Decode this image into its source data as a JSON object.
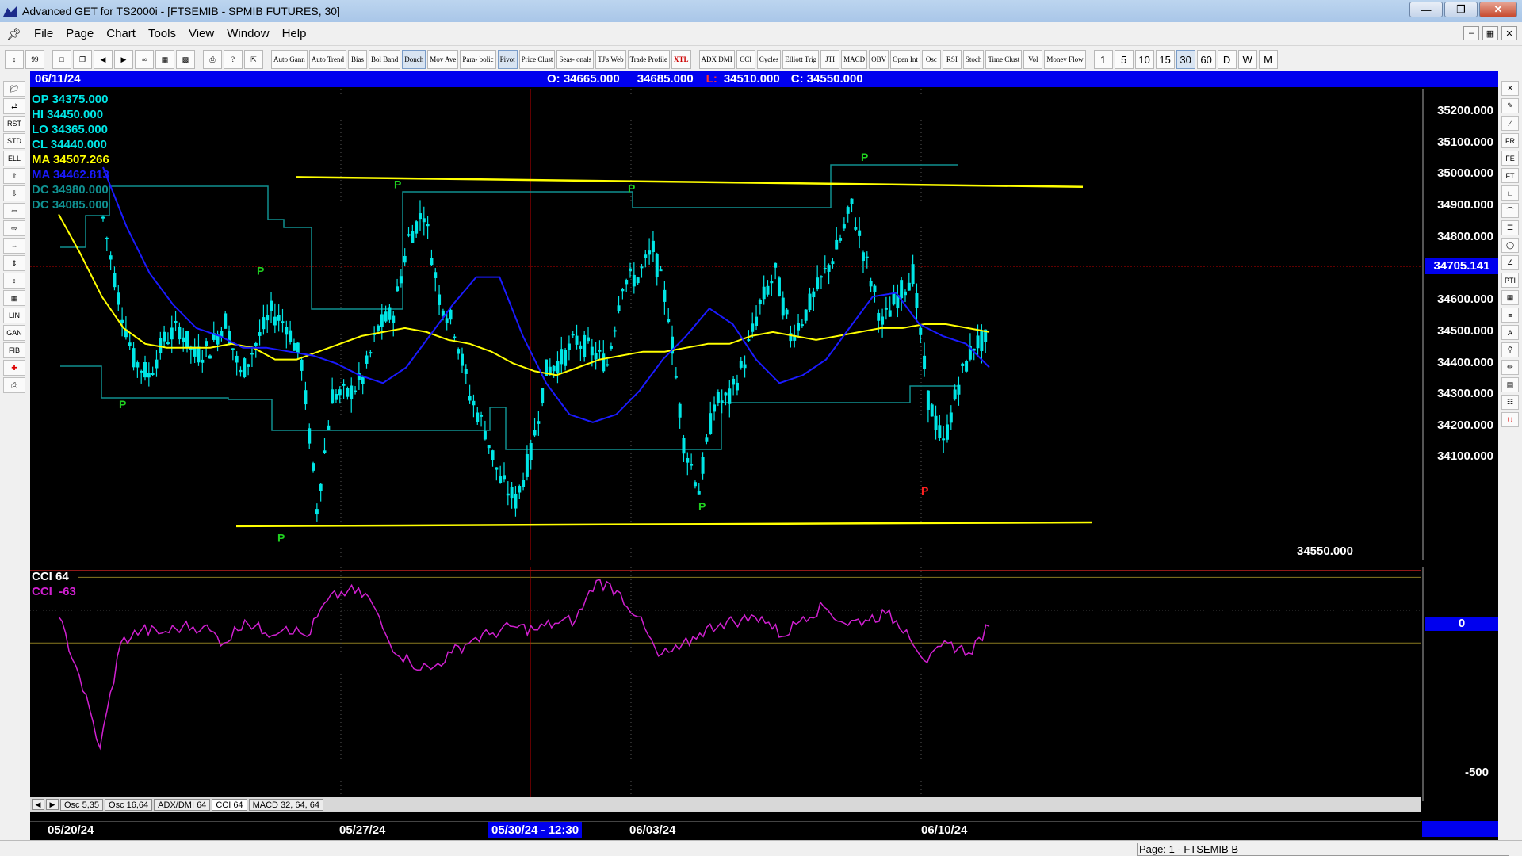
{
  "window": {
    "title": "Advanced GET for TS2000i - [FTSEMIB - SPMIB FUTURES, 30]",
    "minimize": "—",
    "maximize": "❒",
    "close": "✕"
  },
  "menu": [
    "File",
    "Page",
    "Chart",
    "Tools",
    "View",
    "Window",
    "Help"
  ],
  "toolbar": {
    "studies": [
      "Auto Gann",
      "Auto Trend",
      "Bias",
      "Bol Band",
      "Donch",
      "Mov Ave",
      "Para- bolic",
      "Pivot",
      "Price Clust",
      "Seas- onals",
      "TJ's Web",
      "Trade Profile",
      "XTL"
    ],
    "oscillators": [
      "ADX DMI",
      "CCI",
      "Cycles",
      "Elliott Trig",
      "JTI",
      "MACD",
      "OBV",
      "Open Int",
      "Osc",
      "RSI",
      "Stoch",
      "Time Clust",
      "Vol",
      "Money Flow"
    ],
    "intervals": [
      "1",
      "5",
      "10",
      "15",
      "30",
      "60",
      "D",
      "W",
      "M"
    ],
    "active_interval": "30"
  },
  "infobar": {
    "date": "06/11/24",
    "open": "O: 34665.000",
    "high": "34685.000",
    "low_label": "L:",
    "low": "34510.000",
    "close": "C: 34550.000"
  },
  "legend": [
    {
      "label": "OP",
      "value": "34375.000",
      "color": "#00e6e6"
    },
    {
      "label": "HI",
      "value": "34450.000",
      "color": "#00e6e6"
    },
    {
      "label": "LO",
      "value": "34365.000",
      "color": "#00e6e6"
    },
    {
      "label": "CL",
      "value": "34440.000",
      "color": "#00e6e6"
    },
    {
      "label": "MA",
      "value": "34507.266",
      "color": "#ffff00"
    },
    {
      "label": "MA",
      "value": "34462.813",
      "color": "#1a1aff"
    },
    {
      "label": "DC",
      "value": "34980.000",
      "color": "#109090"
    },
    {
      "label": "DC",
      "value": "34085.000",
      "color": "#109090"
    }
  ],
  "price_scale": {
    "ticks": [
      "35200.000",
      "35100.000",
      "35000.000",
      "34900.000",
      "34800.000",
      "34700.000",
      "34600.000",
      "34500.000",
      "34400.000",
      "34300.000",
      "34200.000",
      "34100.000"
    ],
    "current": "34705.141",
    "last_price": "34550.000"
  },
  "indicator": {
    "title": "CCI 64",
    "value_label": "CCI",
    "value": "-63",
    "scale_zero": "0",
    "scale_low": "-500"
  },
  "tabs": [
    "Osc 5,35",
    "Osc 16,64",
    "ADX/DMI 64",
    "CCI 64",
    "MACD 32, 64, 64"
  ],
  "active_tab": "CCI 64",
  "dates": {
    "d1": "05/20/24",
    "d2": "05/27/24",
    "cursor": "05/30/24 - 12:30",
    "d3": "06/03/24",
    "d4": "06/10/24"
  },
  "pivot_label": "P",
  "status": "Page: 1 - FTSEMIB B",
  "colors": {
    "price_bars": "#00e6e6",
    "ma_fast": "#ffff00",
    "ma_slow": "#1a1aff",
    "donchian": "#109090",
    "cci": "#d020d0",
    "pivot_high": "#20d020",
    "pivot_low_red": "#ff2020",
    "trendline": "#ffff00",
    "cursor": "#c00000"
  },
  "chart_data": {
    "type": "line",
    "series": [
      {
        "name": "price close",
        "values": [
          34920,
          34720,
          34560,
          34520,
          34610,
          34640,
          34570,
          34590,
          34660,
          34520,
          34600,
          34680,
          34650,
          34550,
          34180,
          34470,
          34470,
          34510,
          34640,
          34680,
          34870,
          34940,
          34720,
          34640,
          34470,
          34380,
          34250,
          34200,
          34320,
          34530,
          34560,
          34610,
          34580,
          34550,
          34760,
          34770,
          34840,
          34680,
          34350,
          34230,
          34450,
          34460,
          34560,
          34700,
          34780,
          34620,
          34680,
          34760,
          34840,
          34950,
          34800,
          34650,
          34720,
          34780,
          34460,
          34340,
          34500,
          34600,
          34610
        ]
      },
      {
        "name": "MA",
        "values": [
          34930,
          34830,
          34720,
          34640,
          34600,
          34590,
          34590,
          34590,
          34600,
          34590,
          34560,
          34560,
          34580,
          34600,
          34620,
          34630,
          34640,
          34630,
          34610,
          34600,
          34580,
          34550,
          34530,
          34520,
          34540,
          34560,
          34570,
          34580,
          34580,
          34590,
          34600,
          34600,
          34620,
          34630,
          34620,
          34610,
          34620,
          34630,
          34640,
          34640,
          34650,
          34650,
          34640,
          34630
        ]
      },
      {
        "name": "MA",
        "values": [
          35050,
          34900,
          34780,
          34700,
          34640,
          34620,
          34590,
          34590,
          34580,
          34570,
          34550,
          34520,
          34500,
          34540,
          34620,
          34700,
          34770,
          34770,
          34620,
          34500,
          34420,
          34400,
          34420,
          34480,
          34560,
          34620,
          34690,
          34650,
          34560,
          34500,
          34520,
          34560,
          34640,
          34720,
          34730,
          34650,
          34620,
          34600,
          34540
        ]
      },
      {
        "name": "CCI 64",
        "values": [
          -20,
          -200,
          -420,
          -100,
          -60,
          -70,
          -50,
          -50,
          -100,
          -30,
          -70,
          -50,
          -80,
          30,
          60,
          40,
          -100,
          -160,
          -180,
          -130,
          -90,
          -70,
          -50,
          -60,
          -40,
          -30,
          90,
          60,
          -20,
          -140,
          -120,
          -70,
          -40,
          -30,
          -20,
          -80,
          -20,
          10,
          -40,
          -30,
          -10,
          -60,
          -160,
          -100,
          -130,
          -50
        ]
      }
    ],
    "pivots": [
      {
        "label": "P",
        "date_index": 0,
        "price": 34480
      },
      {
        "label": "P",
        "date_index": 1,
        "price": 34760
      },
      {
        "label": "P",
        "date_index": 2,
        "price": 34140
      },
      {
        "label": "P",
        "date_index": 3,
        "price": 34980
      },
      {
        "label": "P",
        "date_index": 4,
        "price": 34070
      },
      {
        "label": "P",
        "date_index": 5,
        "price": 34970
      },
      {
        "label": "P",
        "date_index": 6,
        "price": 34220
      },
      {
        "label": "P",
        "date_index": 7,
        "price": 35050
      },
      {
        "label": "P",
        "date_index": 8,
        "price": 34260
      }
    ],
    "trendlines": [
      {
        "from": 35025,
        "to": 35000
      },
      {
        "from": 34135,
        "to": 34145
      }
    ],
    "ylim": [
      34050,
      35250
    ],
    "grid": false
  }
}
